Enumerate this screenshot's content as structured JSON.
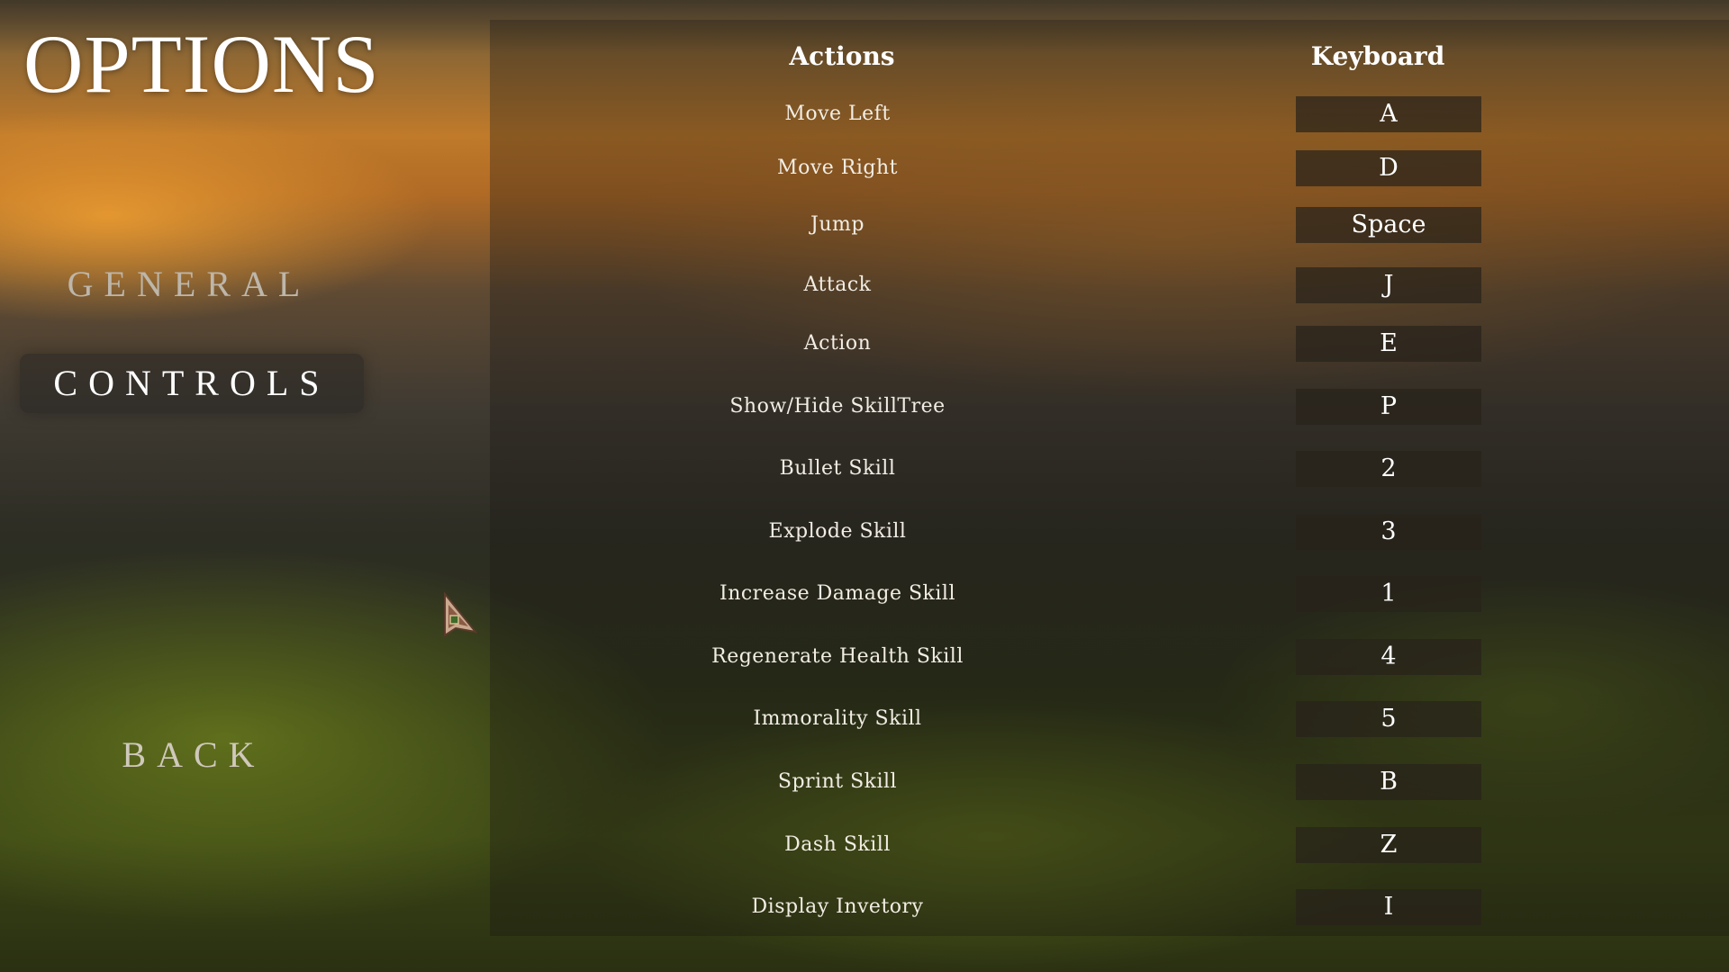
{
  "title": "OPTIONS",
  "menu": {
    "general": "GENERAL",
    "controls": "CONTROLS",
    "back": "BACK"
  },
  "table": {
    "actions_header": "Actions",
    "keyboard_header": "Keyboard",
    "rows": [
      {
        "action": "Move Left",
        "key": "A"
      },
      {
        "action": "Move Right",
        "key": "D"
      },
      {
        "action": "Jump",
        "key": "Space"
      },
      {
        "action": "Attack",
        "key": "J"
      },
      {
        "action": "Action",
        "key": "E"
      },
      {
        "action": "Show/Hide SkillTree",
        "key": "P"
      },
      {
        "action": "Bullet Skill",
        "key": "2"
      },
      {
        "action": "Explode Skill",
        "key": "3"
      },
      {
        "action": "Increase Damage Skill",
        "key": "1"
      },
      {
        "action": "Regenerate Health Skill",
        "key": "4"
      },
      {
        "action": "Immorality Skill",
        "key": "5"
      },
      {
        "action": "Sprint Skill",
        "key": "B"
      },
      {
        "action": "Dash Skill",
        "key": "Z"
      },
      {
        "action": "Display Invetory",
        "key": "I"
      }
    ]
  },
  "icons": {
    "cursor": "arrow-cursor-icon"
  }
}
